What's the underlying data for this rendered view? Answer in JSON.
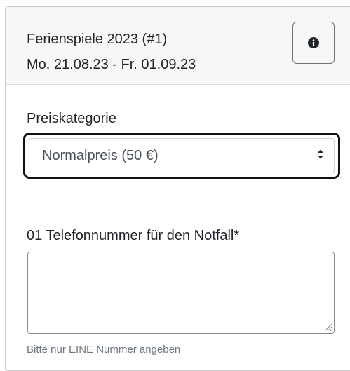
{
  "event": {
    "title": "Ferienspiele 2023 (#1)",
    "dates": "Mo. 21.08.23 - Fr. 01.09.23",
    "info_icon": "info-circle-icon"
  },
  "price": {
    "label": "Preiskategorie",
    "selected": "Normalpreis (50 €)",
    "caret_icon": "sort-caret-icon"
  },
  "phone": {
    "label": "01 Telefonnummer für den Notfall*",
    "value": "",
    "hint": "Bitte nur EINE Nummer angeben",
    "resize_icon": "resize-handle-icon"
  },
  "colors": {
    "header_bg": "#f7f7f7",
    "text": "#212529",
    "muted": "#6c757d",
    "focus_outline": "#111111"
  }
}
